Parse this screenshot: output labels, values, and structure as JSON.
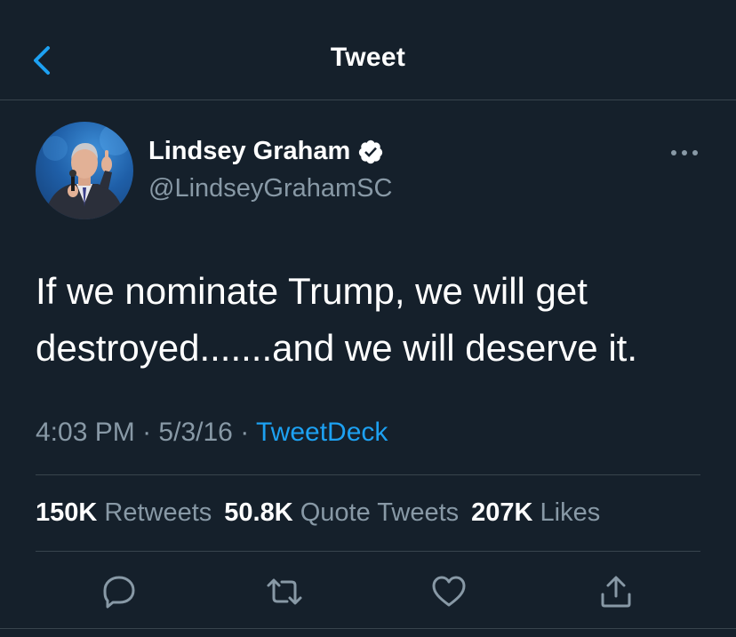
{
  "header": {
    "title": "Tweet",
    "back_icon": "chevron-left-icon"
  },
  "author": {
    "name": "Lindsey Graham",
    "handle": "@LindseyGrahamSC",
    "verified": true
  },
  "tweet": {
    "text_lines": [
      "If we nominate Trump, we will get",
      "destroyed.......and we will deserve it."
    ],
    "time": "4:03 PM",
    "date": "5/3/16",
    "source": "TweetDeck",
    "separator": "·"
  },
  "stats": {
    "retweets_count": "150K",
    "retweets_label": "Retweets",
    "quotes_count": "50.8K",
    "quotes_label": "Quote Tweets",
    "likes_count": "207K",
    "likes_label": "Likes"
  },
  "actions": [
    "reply-icon",
    "retweet-icon",
    "like-icon",
    "share-icon"
  ],
  "colors": {
    "background": "#15202b",
    "accent": "#1da1f2",
    "secondary_text": "#8899a6",
    "divider": "#38444d"
  }
}
